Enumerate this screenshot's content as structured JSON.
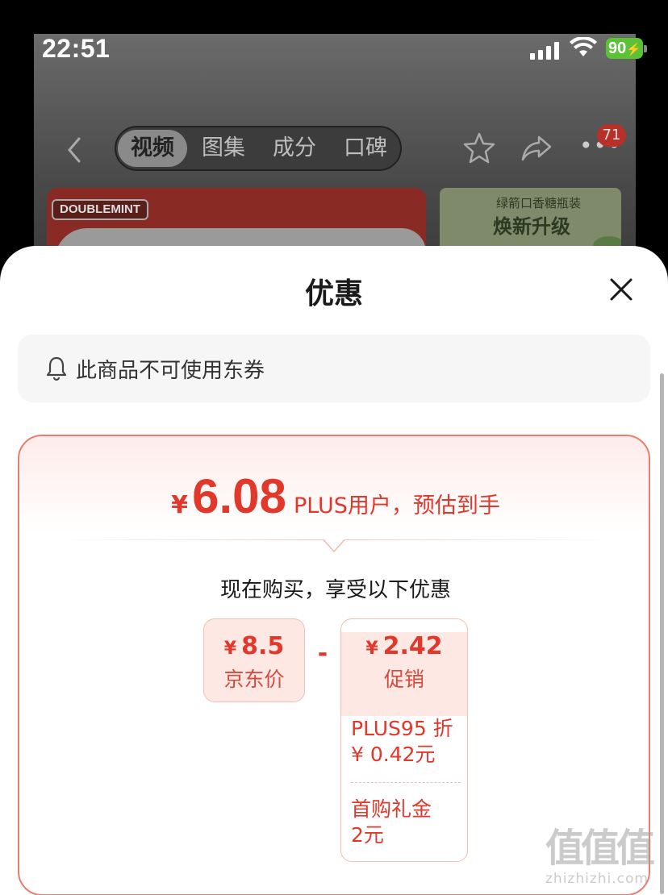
{
  "status_bar": {
    "time": "22:51",
    "battery": "90"
  },
  "nav": {
    "tabs": [
      {
        "label": "视频",
        "active": true
      },
      {
        "label": "图集",
        "active": false
      },
      {
        "label": "成分",
        "active": false
      },
      {
        "label": "口碑",
        "active": false
      }
    ],
    "badge_count": "71"
  },
  "background_banner": {
    "brand": "DOUBLEMINT",
    "right_subtitle": "绿箭口香糖瓶装",
    "right_title": "焕新升级"
  },
  "sheet": {
    "title": "优惠",
    "notice": "此商品不可使用东券",
    "estimate": {
      "currency": "¥",
      "price": "6.08",
      "note": "PLUS用户，预估到手"
    },
    "subtitle": "现在购买，享受以下优惠",
    "jd_price": {
      "currency": "¥",
      "amount": "8.5",
      "label": "京东价"
    },
    "operator": "-",
    "promotion": {
      "currency": "¥",
      "amount": "2.42",
      "label": "促销",
      "items": [
        {
          "line1": "PLUS95 折",
          "line2": "¥ 0.42元"
        },
        {
          "line1": "首购礼金",
          "line2": "2元"
        }
      ]
    }
  },
  "watermark": {
    "glyphs": "值值值",
    "url": "zhizhizhi.com"
  },
  "colors": {
    "accent": "#e2382b",
    "card_border": "#ea7d6e",
    "pill_bg": "#fde8e4",
    "battery": "#5bc236"
  }
}
